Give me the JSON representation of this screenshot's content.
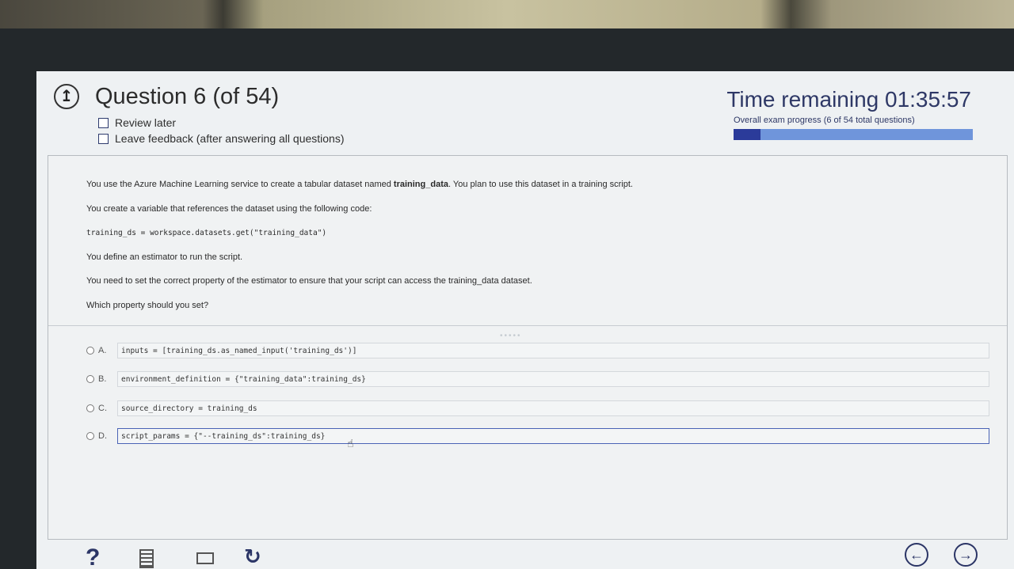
{
  "header": {
    "question_title": "Question 6 (of 54)",
    "review_later": "Review later",
    "leave_feedback": "Leave feedback (after answering all questions)",
    "timer": "Time remaining 01:35:57",
    "progress_label": "Overall exam progress (6 of 54 total questions)",
    "progress_fraction": 0.111
  },
  "stem": {
    "p1_before": "You use the Azure Machine Learning service to create a tabular dataset named ",
    "p1_bold": "training_data",
    "p1_after": ". You plan to use this dataset in a training script.",
    "p2": "You create a variable that references the dataset using the following code:",
    "code": "training_ds = workspace.datasets.get(\"training_data\")",
    "p3": "You define an estimator to run the script.",
    "p4": "You need to set the correct property of the estimator to ensure that your script can access the training_data dataset.",
    "p5": "Which property should you set?"
  },
  "options": [
    {
      "letter": "A.",
      "text": "inputs = [training_ds.as_named_input('training_ds')]"
    },
    {
      "letter": "B.",
      "text": "environment_definition = {\"training_data\":training_ds}"
    },
    {
      "letter": "C.",
      "text": "source_directory = training_ds"
    },
    {
      "letter": "D.",
      "text": "script_params = {\"--training_ds\":training_ds}"
    }
  ],
  "icons": {
    "back": "arrow-up-circle-icon",
    "help": "question-mark-icon",
    "calculator": "calculator-icon",
    "monitor": "monitor-icon",
    "reset": "reset-icon",
    "prev": "arrow-left-circle-icon",
    "next": "arrow-right-circle-icon"
  },
  "colors": {
    "accent": "#2b3566",
    "progress_fill": "#2b3b9a",
    "progress_track": "#6f95db"
  }
}
